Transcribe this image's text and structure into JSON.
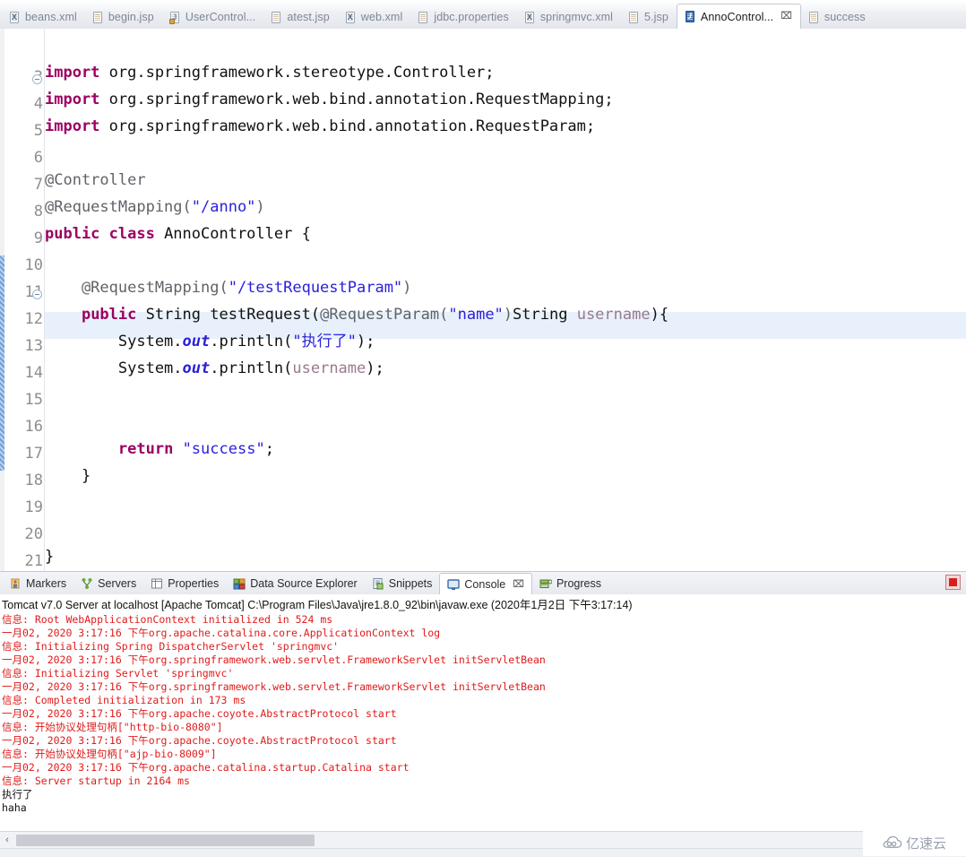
{
  "editor_tabs": [
    {
      "label": "beans.xml",
      "icon": "xml-file-icon",
      "icon_kind": "xml",
      "glyph": "X",
      "active": false,
      "closable": false
    },
    {
      "label": "begin.jsp",
      "icon": "jsp-file-icon",
      "icon_kind": "jsp",
      "glyph": "",
      "active": false,
      "closable": false
    },
    {
      "label": "UserControl...",
      "icon": "java-file-icon",
      "icon_kind": "jspc",
      "glyph": "J",
      "active": false,
      "closable": false
    },
    {
      "label": "atest.jsp",
      "icon": "jsp-file-icon",
      "icon_kind": "jsp",
      "glyph": "",
      "active": false,
      "closable": false
    },
    {
      "label": "web.xml",
      "icon": "xml-file-icon",
      "icon_kind": "xml",
      "glyph": "X",
      "active": false,
      "closable": false
    },
    {
      "label": "jdbc.properties",
      "icon": "properties-file-icon",
      "icon_kind": "jsp",
      "glyph": "",
      "active": false,
      "closable": false
    },
    {
      "label": "springmvc.xml",
      "icon": "xml-file-icon",
      "icon_kind": "xml",
      "glyph": "X",
      "active": false,
      "closable": false
    },
    {
      "label": "5.jsp",
      "icon": "jsp-file-icon",
      "icon_kind": "jsp",
      "glyph": "",
      "active": false,
      "closable": false
    },
    {
      "label": "AnnoControl...",
      "icon": "java-file-icon",
      "icon_kind": "java",
      "glyph": "J",
      "active": true,
      "closable": true,
      "close_glyph": "⌧"
    },
    {
      "label": "success",
      "icon": "jsp-file-icon",
      "icon_kind": "jsp",
      "glyph": "",
      "active": false,
      "closable": false
    }
  ],
  "code": {
    "highlighted_line": 12,
    "lines": [
      {
        "n": "3",
        "fold": true,
        "tokens": [
          {
            "t": "import",
            "c": "k"
          },
          {
            "t": " org.springframework.stereotype.Controller;",
            "c": "pl"
          }
        ]
      },
      {
        "n": "4",
        "fold": false,
        "tokens": [
          {
            "t": "import",
            "c": "k"
          },
          {
            "t": " org.springframework.web.bind.annotation.RequestMapping;",
            "c": "pl"
          }
        ]
      },
      {
        "n": "5",
        "fold": false,
        "tokens": [
          {
            "t": "import",
            "c": "k"
          },
          {
            "t": " org.springframework.web.bind.annotation.RequestParam;",
            "c": "pl"
          }
        ]
      },
      {
        "n": "6",
        "fold": false,
        "tokens": []
      },
      {
        "n": "7",
        "fold": false,
        "tokens": [
          {
            "t": "@Controller",
            "c": "an"
          }
        ]
      },
      {
        "n": "8",
        "fold": false,
        "tokens": [
          {
            "t": "@RequestMapping(",
            "c": "an"
          },
          {
            "t": "\"/anno\"",
            "c": "s"
          },
          {
            "t": ")",
            "c": "an"
          }
        ]
      },
      {
        "n": "9",
        "fold": false,
        "tokens": [
          {
            "t": "public class",
            "c": "k"
          },
          {
            "t": " AnnoController {",
            "c": "pl"
          }
        ]
      },
      {
        "n": "10",
        "fold": false,
        "tokens": []
      },
      {
        "n": "11",
        "fold": true,
        "tokens": [
          {
            "t": "    @RequestMapping(",
            "c": "an"
          },
          {
            "t": "\"/testRequestParam\"",
            "c": "s"
          },
          {
            "t": ")",
            "c": "an"
          }
        ]
      },
      {
        "n": "12",
        "fold": false,
        "tokens": [
          {
            "t": "    ",
            "c": "pl"
          },
          {
            "t": "public",
            "c": "k"
          },
          {
            "t": " String testRequest(",
            "c": "pl"
          },
          {
            "t": "@RequestParam(",
            "c": "an"
          },
          {
            "t": "\"name\"",
            "c": "s"
          },
          {
            "t": ")",
            "c": "an"
          },
          {
            "t": "String ",
            "c": "pl"
          },
          {
            "t": "username",
            "c": "par"
          },
          {
            "t": "){",
            "c": "pl"
          }
        ]
      },
      {
        "n": "13",
        "fold": false,
        "tokens": [
          {
            "t": "        System.",
            "c": "pl"
          },
          {
            "t": "out",
            "c": "fld"
          },
          {
            "t": ".println(",
            "c": "pl"
          },
          {
            "t": "\"执行了\"",
            "c": "s"
          },
          {
            "t": ");",
            "c": "pl"
          }
        ]
      },
      {
        "n": "14",
        "fold": false,
        "tokens": [
          {
            "t": "        System.",
            "c": "pl"
          },
          {
            "t": "out",
            "c": "fld"
          },
          {
            "t": ".println(",
            "c": "pl"
          },
          {
            "t": "username",
            "c": "par"
          },
          {
            "t": ");",
            "c": "pl"
          }
        ]
      },
      {
        "n": "15",
        "fold": false,
        "tokens": []
      },
      {
        "n": "16",
        "fold": false,
        "tokens": []
      },
      {
        "n": "17",
        "fold": false,
        "tokens": [
          {
            "t": "        ",
            "c": "pl"
          },
          {
            "t": "return",
            "c": "k"
          },
          {
            "t": " ",
            "c": "pl"
          },
          {
            "t": "\"success\"",
            "c": "s"
          },
          {
            "t": ";",
            "c": "pl"
          }
        ]
      },
      {
        "n": "18",
        "fold": false,
        "tokens": [
          {
            "t": "    }",
            "c": "pl"
          }
        ]
      },
      {
        "n": "19",
        "fold": false,
        "tokens": []
      },
      {
        "n": "20",
        "fold": false,
        "tokens": []
      },
      {
        "n": "21",
        "fold": false,
        "tokens": [
          {
            "t": "}",
            "c": "pl"
          }
        ]
      }
    ]
  },
  "view_tabs": [
    {
      "label": "Markers",
      "icon": "markers-icon",
      "active": false,
      "closable": false
    },
    {
      "label": "Servers",
      "icon": "servers-icon",
      "active": false,
      "closable": false
    },
    {
      "label": "Properties",
      "icon": "properties-icon",
      "active": false,
      "closable": false
    },
    {
      "label": "Data Source Explorer",
      "icon": "data-source-explorer-icon",
      "active": false,
      "closable": false
    },
    {
      "label": "Snippets",
      "icon": "snippets-icon",
      "active": false,
      "closable": false
    },
    {
      "label": "Console",
      "icon": "console-icon",
      "active": true,
      "closable": true,
      "close_glyph": "⌧"
    },
    {
      "label": "Progress",
      "icon": "progress-icon",
      "active": false,
      "closable": false
    }
  ],
  "console": {
    "header": "Tomcat v7.0 Server at localhost [Apache Tomcat] C:\\Program Files\\Java\\jre1.8.0_92\\bin\\javaw.exe (2020年1月2日 下午3:17:14)",
    "stop_button_title": "Terminate",
    "lines": [
      {
        "text": "信息: Root WebApplicationContext initialized in 524 ms",
        "kind": "err"
      },
      {
        "text": "一月02, 2020 3:17:16 下午org.apache.catalina.core.ApplicationContext log",
        "kind": "err"
      },
      {
        "text": "信息: Initializing Spring DispatcherServlet 'springmvc'",
        "kind": "err"
      },
      {
        "text": "一月02, 2020 3:17:16 下午org.springframework.web.servlet.FrameworkServlet initServletBean",
        "kind": "err"
      },
      {
        "text": "信息: Initializing Servlet 'springmvc'",
        "kind": "err"
      },
      {
        "text": "一月02, 2020 3:17:16 下午org.springframework.web.servlet.FrameworkServlet initServletBean",
        "kind": "err"
      },
      {
        "text": "信息: Completed initialization in 173 ms",
        "kind": "err"
      },
      {
        "text": "一月02, 2020 3:17:16 下午org.apache.coyote.AbstractProtocol start",
        "kind": "err"
      },
      {
        "text": "信息: 开始协议处理句柄[\"http-bio-8080\"]",
        "kind": "err"
      },
      {
        "text": "一月02, 2020 3:17:16 下午org.apache.coyote.AbstractProtocol start",
        "kind": "err"
      },
      {
        "text": "信息: 开始协议处理句柄[\"ajp-bio-8009\"]",
        "kind": "err"
      },
      {
        "text": "一月02, 2020 3:17:16 下午org.apache.catalina.startup.Catalina start",
        "kind": "err"
      },
      {
        "text": "信息: Server startup in 2164 ms",
        "kind": "err"
      },
      {
        "text": "执行了",
        "kind": "out"
      },
      {
        "text": "haha",
        "kind": "out"
      }
    ]
  },
  "scrollbar": {
    "left_arrow": "‹"
  },
  "watermark": {
    "text": "亿速云",
    "icon": "cloud-icon"
  },
  "colors": {
    "keyword": "#9c0061",
    "string": "#2a22da",
    "annotation": "#5f6368",
    "static_field": "#2b20d8",
    "parameter": "#9a7a8e",
    "console_error": "#e01b1b",
    "highlight_row": "#e8f1fb",
    "tab_active_bg": "#ffffff"
  }
}
